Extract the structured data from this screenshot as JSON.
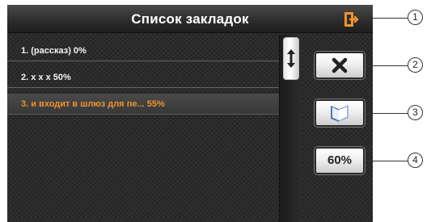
{
  "window": {
    "title": "Список закладок"
  },
  "bookmarks": [
    {
      "label": "1. (рассказ) 0%",
      "selected": false
    },
    {
      "label": "2. x x x 50%",
      "selected": false
    },
    {
      "label": "3. и входит в шлюз для пе... 55%",
      "selected": true
    }
  ],
  "buttons": {
    "exit_icon": "exit-door-icon",
    "close_icon": "close-x-icon",
    "book_icon": "open-book-icon",
    "scroll_icon": "scroll-up-down-icon",
    "zoom_label": "60%"
  },
  "callouts": [
    "1",
    "2",
    "3",
    "4"
  ],
  "colors": {
    "accent": "#f0922a",
    "background": "#2b2b2b",
    "text": "#f2f2f2"
  }
}
